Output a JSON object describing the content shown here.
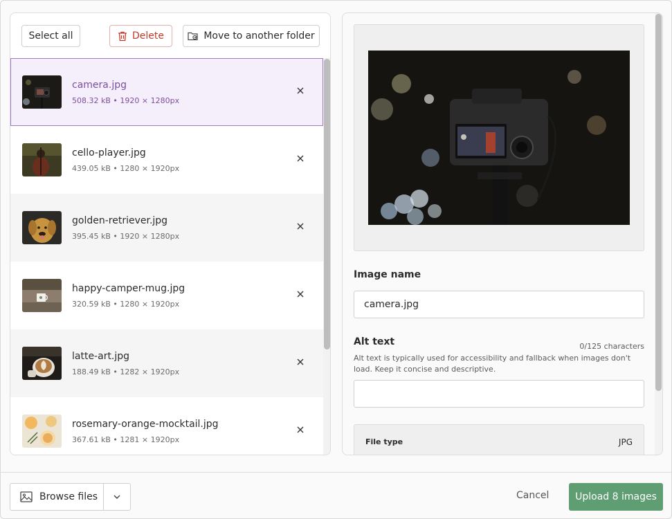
{
  "toolbar": {
    "select_all": "Select all",
    "delete": "Delete",
    "move": "Move to another folder"
  },
  "files": [
    {
      "name": "camera.jpg",
      "meta": "508.32 kB • 1920 × 1280px",
      "selected": true
    },
    {
      "name": "cello-player.jpg",
      "meta": "439.05 kB • 1280 × 1920px"
    },
    {
      "name": "golden-retriever.jpg",
      "meta": "395.45 kB • 1920 × 1280px"
    },
    {
      "name": "happy-camper-mug.jpg",
      "meta": "320.59 kB • 1280 × 1920px"
    },
    {
      "name": "latte-art.jpg",
      "meta": "188.49 kB • 1282 × 1920px"
    },
    {
      "name": "rosemary-orange-mocktail.jpg",
      "meta": "367.61 kB • 1281 × 1920px"
    }
  ],
  "details": {
    "image_name_label": "Image name",
    "image_name_value": "camera.jpg",
    "alt_text_label": "Alt text",
    "char_count": "0/125 characters",
    "alt_help": "Alt text is typically used for accessibility and fallback when images don't load. Keep it concise and descriptive.",
    "alt_value": "",
    "file_type_label": "File type",
    "file_type_value": "JPG"
  },
  "footer": {
    "browse": "Browse files",
    "cancel": "Cancel",
    "upload": "Upload 8 images"
  },
  "colors": {
    "accent_purple": "#7b4f9e",
    "selected_bg": "#f5eefb",
    "delete_red": "#c0392b",
    "upload_green": "#5f9e73"
  }
}
